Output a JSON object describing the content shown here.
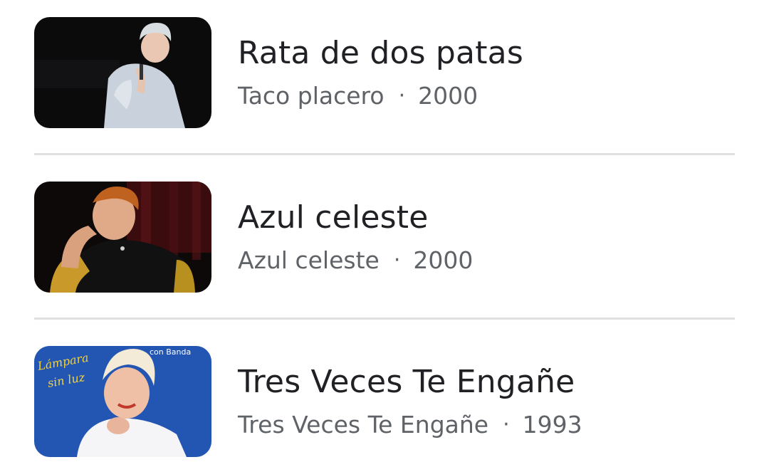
{
  "results": [
    {
      "title": "Rata de dos patas",
      "album": "Taco placero",
      "separator": "·",
      "year": "2000",
      "thumbnail": "singer-on-stage-photo"
    },
    {
      "title": "Azul celeste",
      "album": "Azul celeste",
      "separator": "·",
      "year": "2000",
      "thumbnail": "singer-portrait-photo"
    },
    {
      "title": "Tres Veces Te Engañe",
      "album": "Tres Veces Te Engañe",
      "separator": "·",
      "year": "1993",
      "thumbnail": "album-cover-photo",
      "cover_text_left": "Lámpara sin luz",
      "cover_text_right": "con Banda"
    }
  ],
  "colors": {
    "title": "#202124",
    "meta": "#5f6368",
    "divider": "#e0e0e0"
  }
}
